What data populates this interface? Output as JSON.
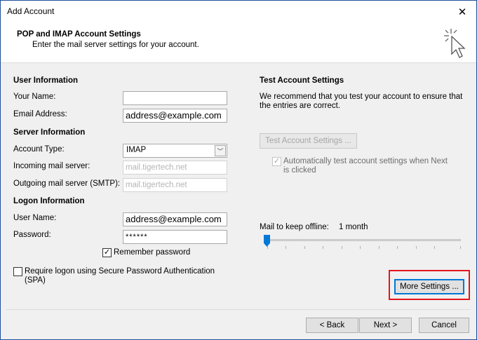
{
  "window": {
    "title": "Add Account"
  },
  "header": {
    "title": "POP and IMAP Account Settings",
    "subtitle": "Enter the mail server settings for your account."
  },
  "user_info": {
    "section": "User Information",
    "name_label": "Your Name:",
    "name_value": "",
    "email_label": "Email Address:",
    "email_value": "address@example.com"
  },
  "server_info": {
    "section": "Server Information",
    "account_type_label": "Account Type:",
    "account_type_value": "IMAP",
    "incoming_label": "Incoming mail server:",
    "incoming_value": "mail.tigertech.net",
    "outgoing_label": "Outgoing mail server (SMTP):",
    "outgoing_value": "mail.tigertech.net"
  },
  "logon_info": {
    "section": "Logon Information",
    "username_label": "User Name:",
    "username_value": "address@example.com",
    "password_label": "Password:",
    "password_value": "******",
    "remember_label": "Remember password",
    "remember_checked": true,
    "spa_label_line1": "Require logon using Secure Password Authentication",
    "spa_label_line2": "(SPA)",
    "spa_checked": false
  },
  "test_settings": {
    "section": "Test Account Settings",
    "desc_line1": "We recommend that you test your account to ensure that",
    "desc_line2": "the entries are correct.",
    "test_button": "Test Account Settings ...",
    "auto_test_line1": "Automatically test account settings when Next",
    "auto_test_line2": "is clicked",
    "auto_test_checked": true
  },
  "offline": {
    "label": "Mail to keep offline:",
    "value": "1 month",
    "slider_fraction": 0
  },
  "buttons": {
    "more_settings": "More Settings ...",
    "back": "< Back",
    "next": "Next >",
    "cancel": "Cancel"
  },
  "icons": {
    "close": "close-icon",
    "cursor": "cursor-click-icon"
  },
  "colors": {
    "highlight": "#e5141c",
    "accent": "#0078d7"
  }
}
